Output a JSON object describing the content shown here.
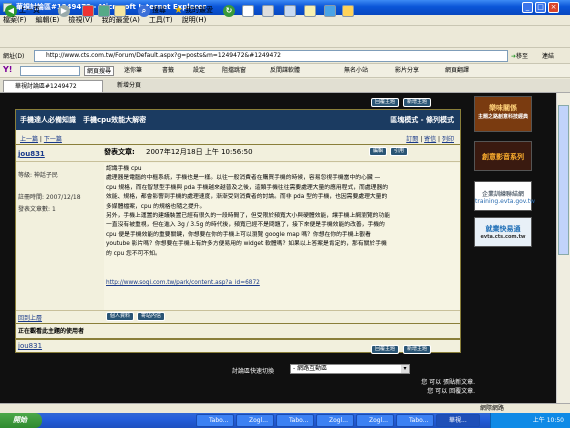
{
  "window": {
    "title": "華視討論區#1249472 - Microsoft Internet Explorer"
  },
  "menu": [
    "檔案(F)",
    "編輯(E)",
    "檢視(V)",
    "我的最愛(A)",
    "工具(T)",
    "說明(H)"
  ],
  "toolbar": {
    "back": "上一頁",
    "search": "搜尋",
    "favorites": "我的最愛"
  },
  "address": {
    "label": "網址(D)",
    "url": "http://www.cts.com.tw/Forum/Default.aspx?g=posts&m=1249472&#1249472",
    "go": "移至",
    "links": "連結"
  },
  "yahoo": {
    "search_btn": "網頁搜尋",
    "items": [
      "迷你筆",
      "書籤",
      "設定",
      "阻擋跳窗",
      "反間諜軟體",
      "無名小站",
      "影片分享",
      "網頁翻譯"
    ]
  },
  "tabs": {
    "tab1": "華視討論區#1249472",
    "tab2": "新增分頁"
  },
  "forum": {
    "top_buttons": [
      "回覆主題",
      "新增主題"
    ],
    "topic_title": "手機達人必備知識　手機cpu效能大解密",
    "mode_label": "區塊模式 - 條列模式",
    "prev": "上一篇",
    "next": "下一篇",
    "subscribe": "訂閱",
    "email": "寄信",
    "print": "列印",
    "author": "jou831",
    "post_date_label": "發表文章:",
    "post_date": "2007年12月18日 上午 10:56:50",
    "edit_buttons": [
      "編輯",
      "引用"
    ],
    "user_level": "等級: 神話子民",
    "join_label": "註冊時間:",
    "join_date": "2007/12/18",
    "posts_label": "發表文章數:",
    "posts_count": "1",
    "body_lines": [
      "認識手機 cpu",
      "處理器是電腦的中樞系統，手機也是一樣。以往一般消費者在購買手機的時候，容易忽視手機當中的心臟 —",
      "cpu 規格，而在智慧型手機與 pda 手機越來越普及之後，這類手機往往需要處理大量的應用程式，而處理器的",
      "效能、規格，都會影響到手機的處理速度，漸漸受到消費者的討論。而非 pda 型的手機，也因需要處理大量的",
      "多媒體檔案，cpu 的規格也隨之提升。",
      "另外，手機上運置的建議裝置已經有很久的一段時間了，但受限於頻寬大小與硬體效能，讓手機上網瀏覽的功能",
      "一直沒有被重視，但在進入 3g / 3.5g 的時代後，頻寬已經不是問題了，接下來便是手機效能的改善，手機的",
      "cpu 便是手機效能的重要關鍵，你想要在你的手機上可以瀏覽 google map 嗎？你想在你的手機上觀看",
      "youtube 影片嗎？你想要在手機上有許多方便易用的 widget 軟體嗎？如果以上答案是肯定的，那有關於手機",
      "的 cpu 您不可不知。"
    ],
    "post_link": "http://www.sogi.com.tw/park/content.asp?a_id=6872",
    "back_top": "回到上層",
    "profile_buttons": [
      "個人資料",
      "寄站內信"
    ],
    "viewing_title": "正在觀看此主題的使用者",
    "viewing_user": "jou831",
    "bottom_buttons": [
      "回覆主題",
      "新增主題"
    ],
    "forum_switch_label": "討論區快速切換",
    "forum_switch_value": "- 網路互動區",
    "permission1": "您 可以 張貼新文章.",
    "permission2": "您 可以 回覆文章."
  },
  "ads": {
    "ad1": "樂味關係",
    "ad1_sub": "主題之路創意科技經典",
    "ad2": "創意影音系列",
    "ad3": "企業訓練聯結網",
    "ad3_url": "training.evta.gov.tw",
    "ad4": "就業快易通",
    "ad4_url": "evta.cts.com.tw"
  },
  "status": {
    "zone": "網際網路"
  },
  "taskbar": {
    "start": "開始",
    "tasks": [
      "Tabo...",
      "Zogl...",
      "Tabo...",
      "Zogl...",
      "Zogl...",
      "Tabo...",
      "華視..."
    ],
    "clock": "上午 10:50"
  },
  "colors": {
    "forum_header": "#1b3b61",
    "page_bg": "#101010",
    "post_bg": "#f6f4e3"
  }
}
